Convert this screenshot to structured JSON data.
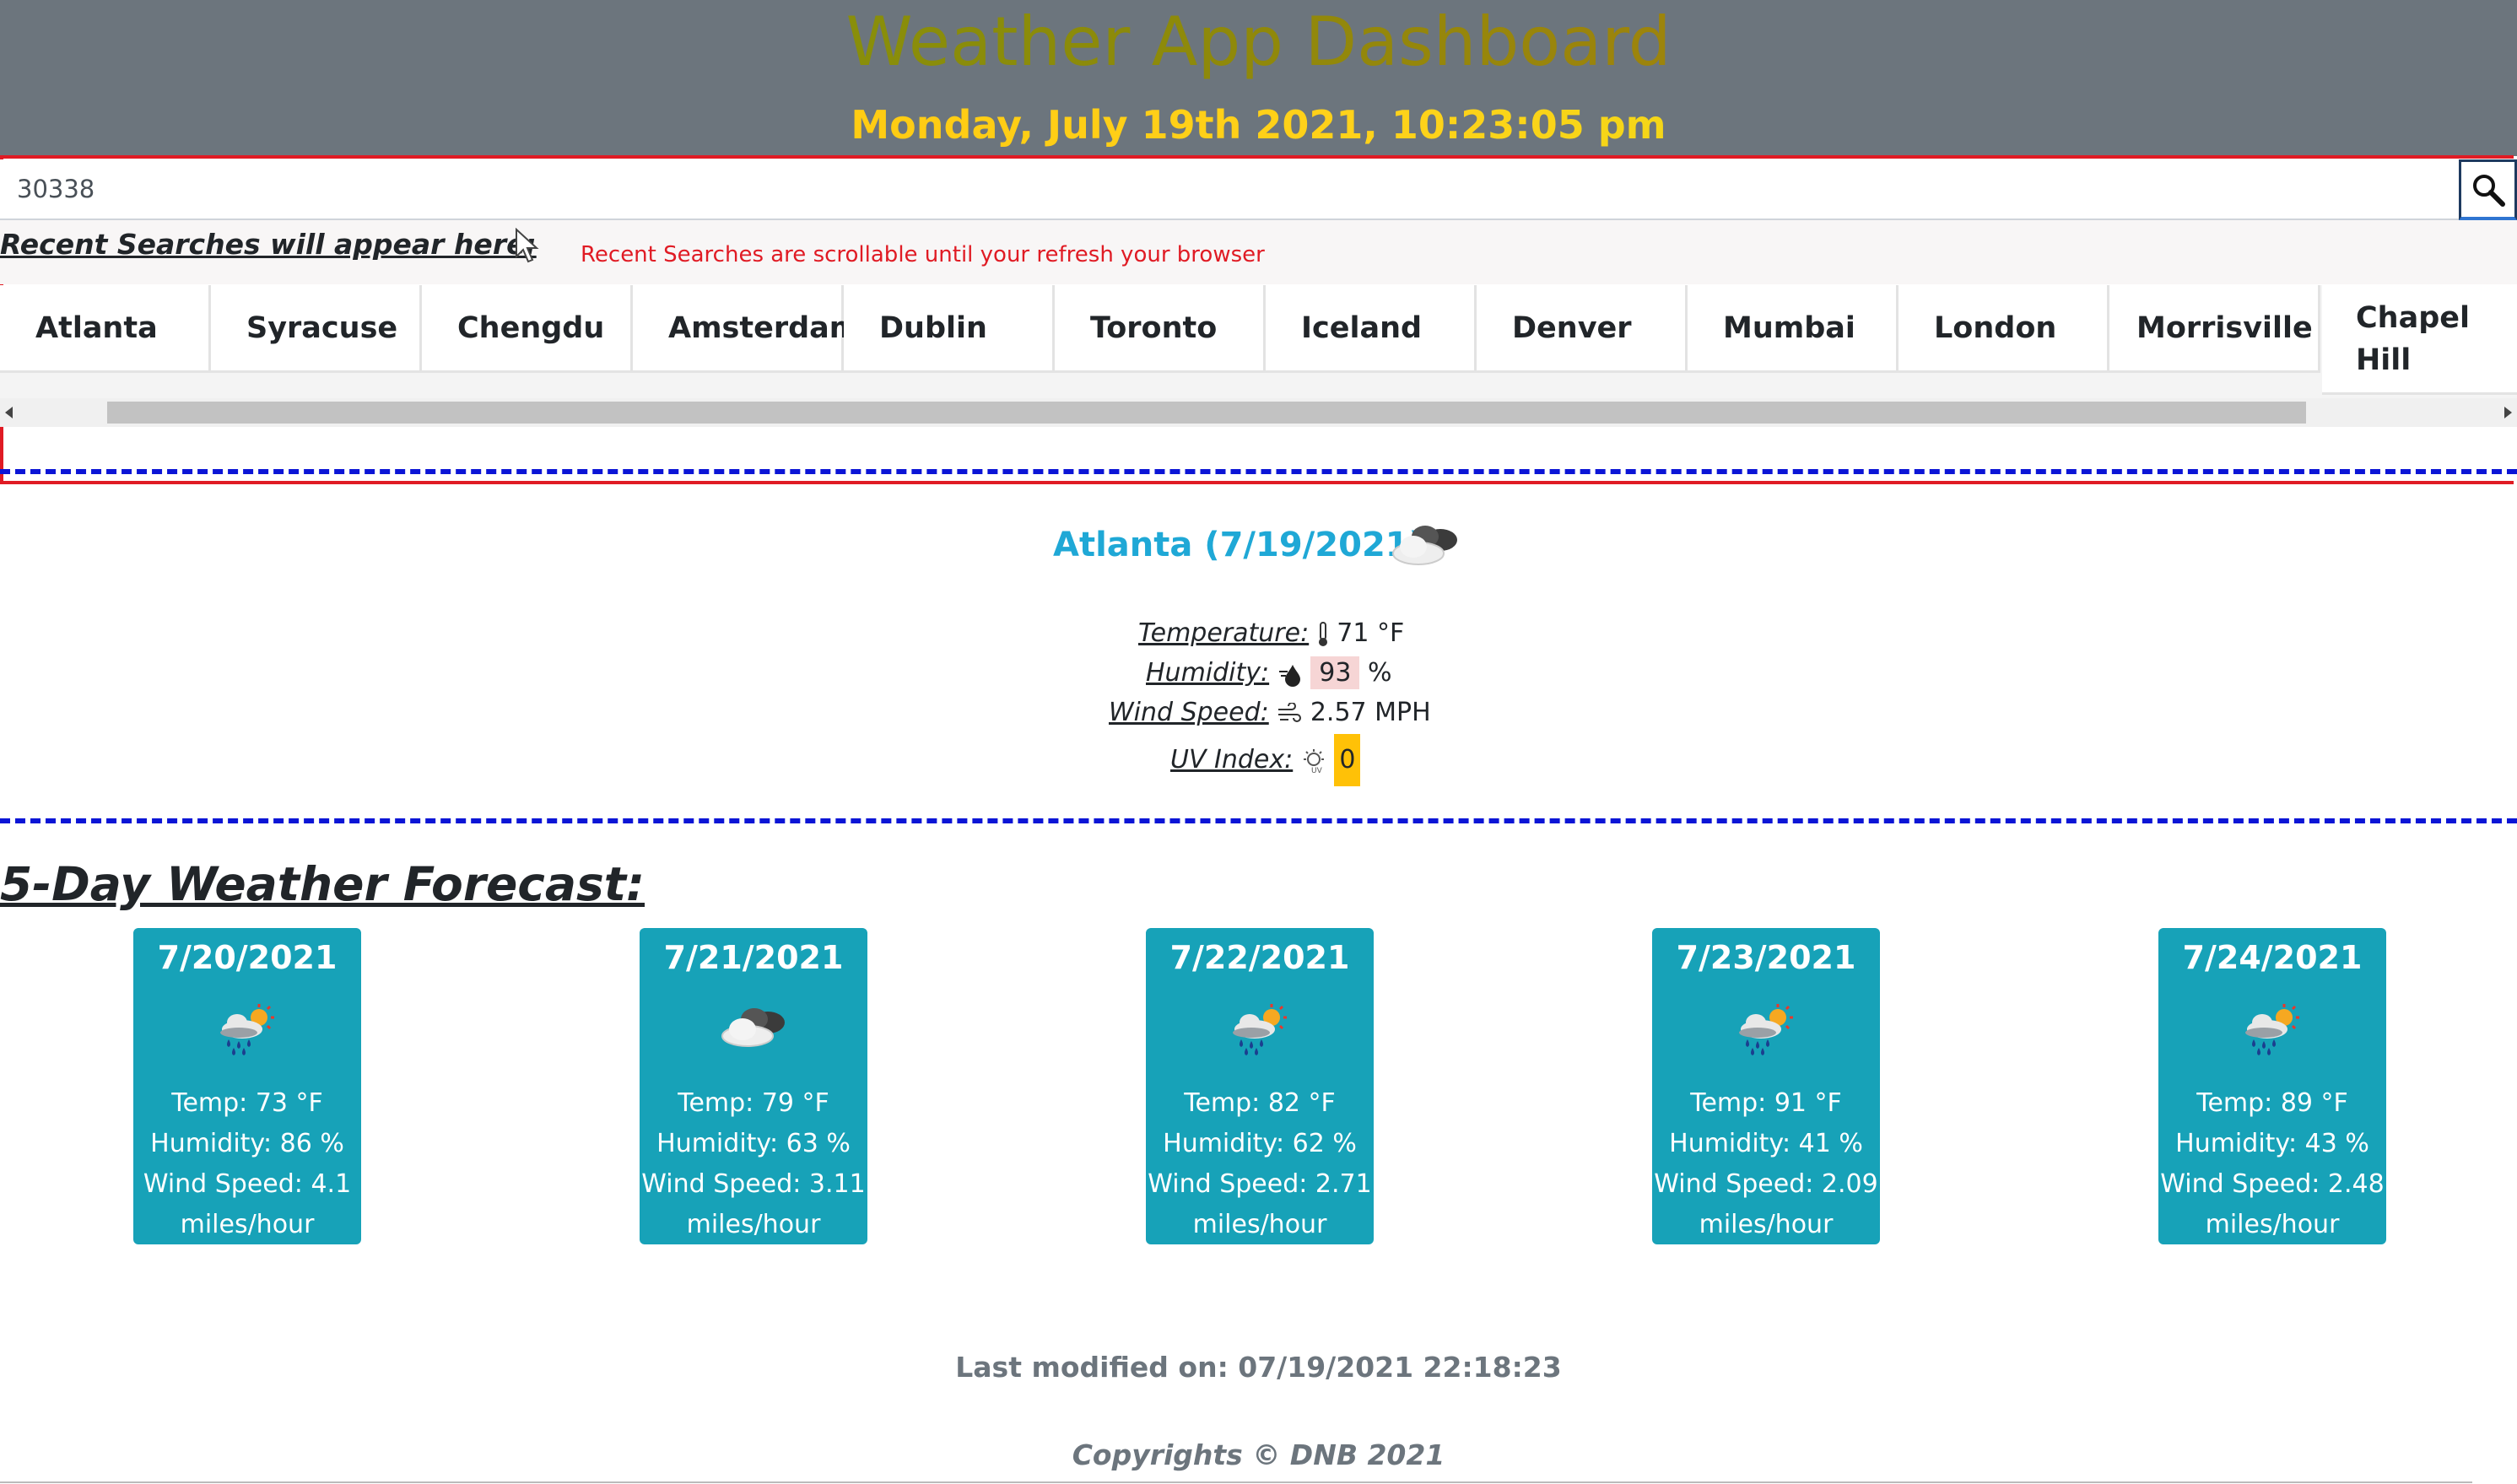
{
  "header": {
    "title": "Weather App Dashboard",
    "datetime": "Monday, July 19th 2021, 10:23:05 pm"
  },
  "search": {
    "value": "30338",
    "button_icon": "search-icon"
  },
  "recent": {
    "heading": "Recent Searches will appear here:",
    "note": "Recent Searches are scrollable until your refresh your browser",
    "cities": [
      "Atlanta",
      "Syracuse",
      "Chengdu",
      "Amsterdam",
      "Dublin",
      "Toronto",
      "Iceland",
      "Denver",
      "Mumbai",
      "London",
      "Morrisville",
      "Chapel Hill"
    ]
  },
  "current": {
    "city_line": "Atlanta (7/19/2021)",
    "icon": "cloudy-icon",
    "temperature_label": "Temperature:",
    "temperature_value": "71 °F",
    "humidity_label": "Humidity:",
    "humidity_value": "93",
    "humidity_unit": "%",
    "wind_label": "Wind Speed:",
    "wind_value": "2.57 MPH",
    "uv_label": "UV Index:",
    "uv_value": "0"
  },
  "forecast": {
    "title": "5-Day Weather Forecast:",
    "days": [
      {
        "date": "7/20/2021",
        "icon": "rain-sun-icon",
        "temp": "Temp: 73 °F",
        "humidity": "Humidity: 86 %",
        "wind": "Wind Speed: 4.1",
        "wind_unit": "miles/hour"
      },
      {
        "date": "7/21/2021",
        "icon": "cloudy-icon",
        "temp": "Temp: 79 °F",
        "humidity": "Humidity: 63 %",
        "wind": "Wind Speed: 3.11",
        "wind_unit": "miles/hour"
      },
      {
        "date": "7/22/2021",
        "icon": "rain-sun-icon",
        "temp": "Temp: 82 °F",
        "humidity": "Humidity: 62 %",
        "wind": "Wind Speed: 2.71",
        "wind_unit": "miles/hour"
      },
      {
        "date": "7/23/2021",
        "icon": "rain-sun-icon",
        "temp": "Temp: 91 °F",
        "humidity": "Humidity: 41 %",
        "wind": "Wind Speed: 2.09",
        "wind_unit": "miles/hour"
      },
      {
        "date": "7/24/2021",
        "icon": "rain-sun-icon",
        "temp": "Temp: 89 °F",
        "humidity": "Humidity: 43 %",
        "wind": "Wind Speed: 2.48",
        "wind_unit": "miles/hour"
      }
    ]
  },
  "footer": {
    "last_modified": "Last modified on: 07/19/2021 22:18:23",
    "copyright": "Copyrights © DNB 2021"
  },
  "colors": {
    "header_bg": "#6c757d",
    "accent_red": "#e01b24",
    "dash_blue": "#0b15d6",
    "card_bg": "#17a2b8",
    "city_blue": "#1fa8d6",
    "uv_badge": "#ffc107",
    "humidity_badge": "#f6d5d5"
  }
}
